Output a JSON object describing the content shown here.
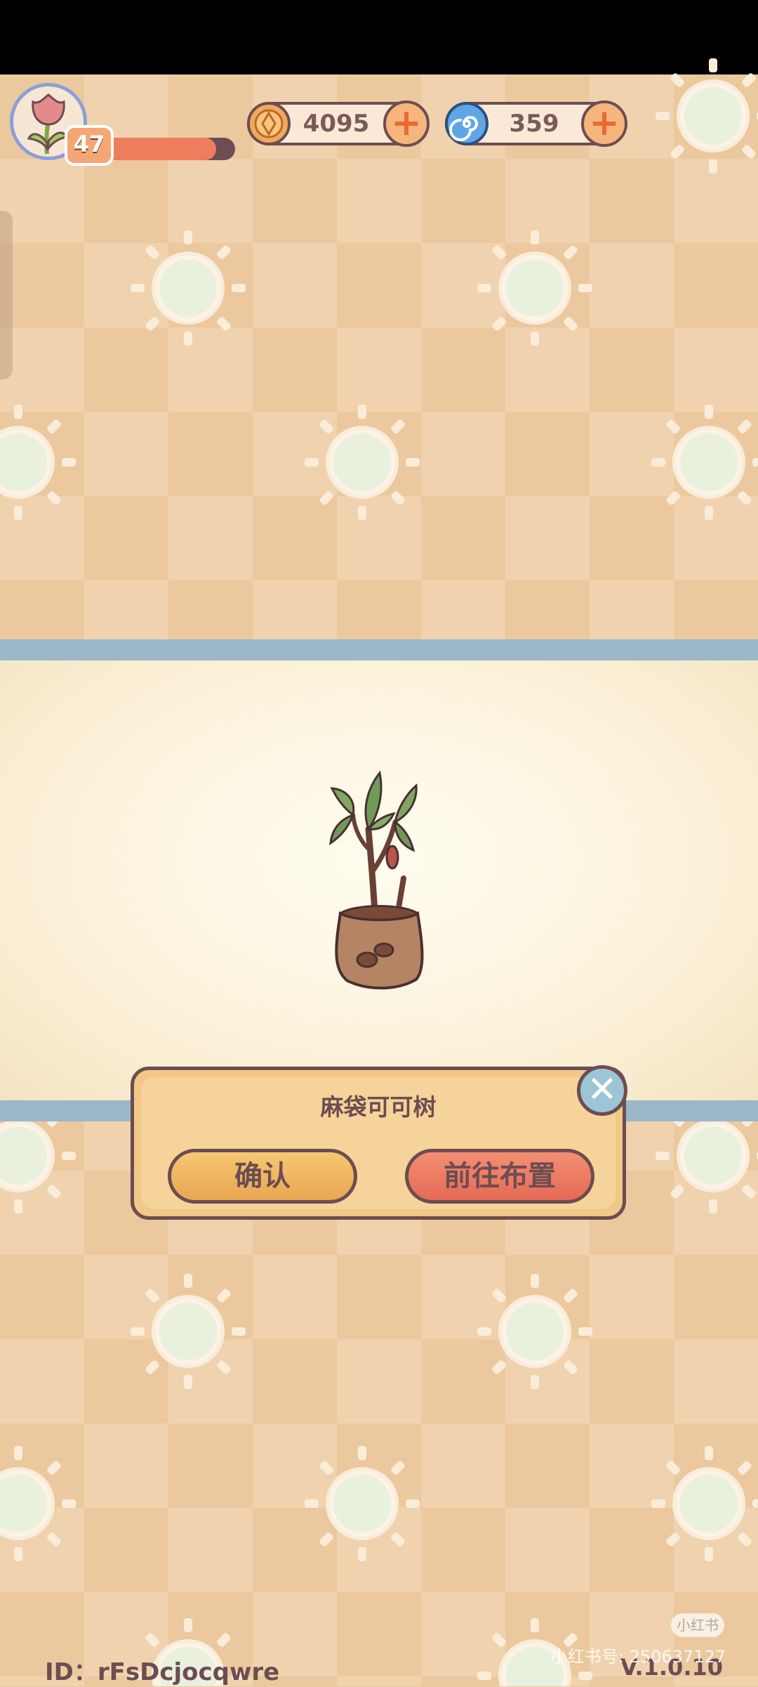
{
  "hud": {
    "level": "47",
    "xp_fraction": 0.86,
    "coins": "4095",
    "gems": "359",
    "plus_label": "+"
  },
  "reward": {
    "item_name": "麻袋可可树",
    "confirm_label": "确认",
    "goto_label": "前往布置",
    "close_label": "✕"
  },
  "footer": {
    "player_id": "ID：rFsDcjocqwre",
    "version": "V.1.0.10"
  },
  "watermark": {
    "logo": "小红书",
    "text": "小红书号: 250637127"
  },
  "colors": {
    "checker_light": "#f0d2ae",
    "checker_dark": "#ecc89f",
    "stripe": "#9bb7c8",
    "outline": "#6c4d51",
    "confirm_button": "#eaa552",
    "goto_button": "#e56a55",
    "close_button": "#9cc5d6"
  },
  "icons": {
    "avatar": "tulip-icon",
    "coin": "coin-icon",
    "gem": "spiral-gem-icon",
    "close": "close-icon"
  }
}
